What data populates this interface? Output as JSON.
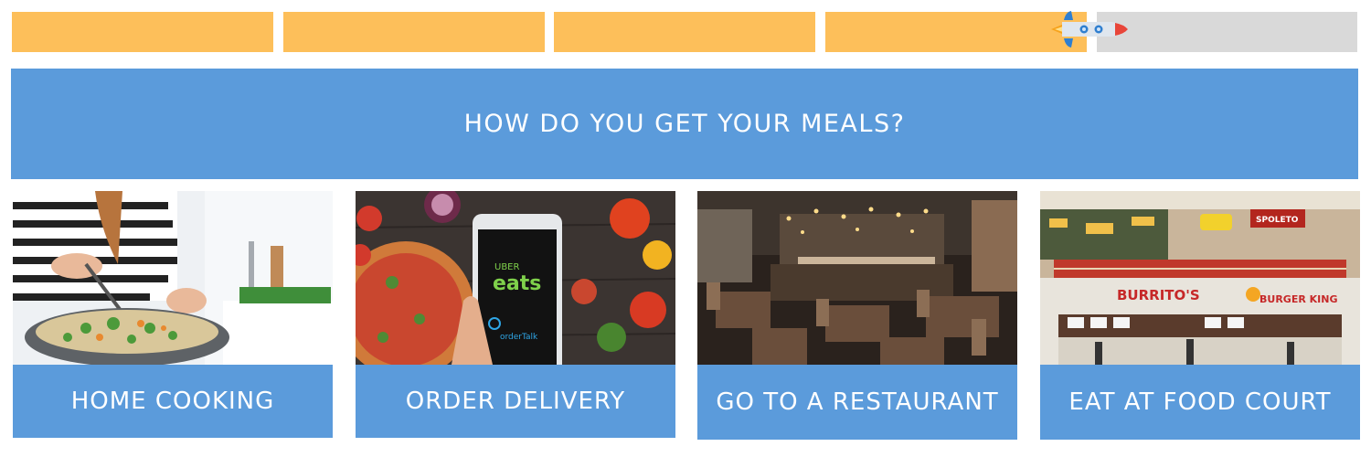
{
  "progress": {
    "total_steps": 5,
    "completed_steps": 4
  },
  "question": {
    "title": "HOW DO YOU GET YOUR MEALS?"
  },
  "options": [
    {
      "label": "HOME COOKING",
      "image": "home-cooking-photo"
    },
    {
      "label": "ORDER DELIVERY",
      "image": "food-delivery-app-photo"
    },
    {
      "label": "GO TO A RESTAURANT",
      "image": "restaurant-interior-photo"
    },
    {
      "label": "EAT AT FOOD COURT",
      "image": "food-court-photo"
    }
  ],
  "photo_text": {
    "delivery_brand_top": "UBER",
    "delivery_brand_main": "eats",
    "delivery_app2": "orderTalk",
    "sign_burritos": "BURRITO'S",
    "sign_burger_king": "BURGER KING",
    "sign_spoleto": "SPOLETO"
  },
  "colors": {
    "accent_blue": "#5b9bdb",
    "progress_done": "#fdbf5a",
    "progress_todo": "#d9d9d9"
  }
}
